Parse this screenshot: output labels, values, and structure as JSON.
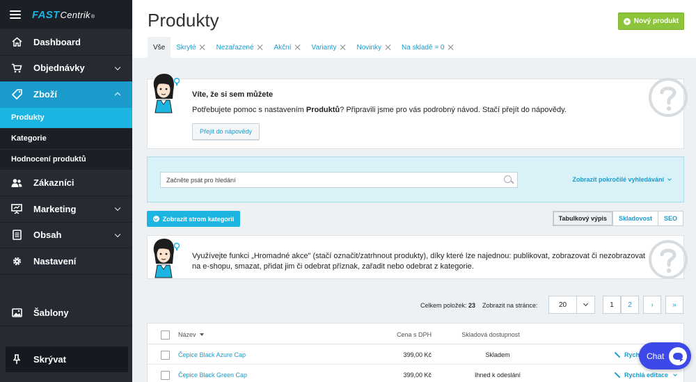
{
  "app": {
    "logo_fast": "FAST",
    "logo_centrik": "Centrik",
    "logo_reg": "®"
  },
  "sidebar": {
    "items": [
      {
        "label": "Dashboard",
        "icon": "home-icon"
      },
      {
        "label": "Objednávky",
        "icon": "cart-icon"
      },
      {
        "label": "Zboží",
        "icon": "tag-icon"
      },
      {
        "label": "Zákazníci",
        "icon": "users-icon"
      },
      {
        "label": "Marketing",
        "icon": "presentation-icon"
      },
      {
        "label": "Obsah",
        "icon": "document-icon"
      },
      {
        "label": "Nastavení",
        "icon": "gear-icon"
      },
      {
        "label": "Šablony",
        "icon": "image-icon"
      }
    ],
    "subitems": [
      {
        "label": "Produkty"
      },
      {
        "label": "Kategorie"
      },
      {
        "label": "Hodnocení produktů"
      }
    ],
    "hide_label": "Skrývat",
    "active_color": "#1a9bcb"
  },
  "header": {
    "title": "Produkty",
    "new_button": "Nový produkt",
    "new_button_color": "#8cc43c"
  },
  "tabs": [
    {
      "label": "Vše",
      "active": true
    },
    {
      "label": "Skryté"
    },
    {
      "label": "Nezařazené"
    },
    {
      "label": "Akční"
    },
    {
      "label": "Varianty"
    },
    {
      "label": "Novinky"
    },
    {
      "label": "Na skladě = 0"
    }
  ],
  "tip1": {
    "title": "Víte, že si sem můžete",
    "text_before": "Potřebujete pomoc s nastavením ",
    "text_bold": "Produktů",
    "text_after": "? Připravili jsme pro vás podrobný návod. Stačí přejít do nápovědy.",
    "button": "Přejít do nápovědy"
  },
  "search": {
    "placeholder": "Začněte psát pro hledání",
    "advanced": "Zobrazit pokročilé vyhledávání"
  },
  "toolbar": {
    "tree_button": "Zobrazit strom kategorií",
    "views": [
      "Tabulkový výpis",
      "Skladovost",
      "SEO"
    ],
    "active_view": "Tabulkový výpis"
  },
  "tip2": {
    "text": "Využívejte funkci „Hromadné akce\" (stačí označit/zatrhnout produkty), díky které lze najednou: publikovat, zobrazovat či nezobrazovat na e-shopu, smazat, přidat jim či odebrat příznak, zařadit nebo odebrat z kategorie."
  },
  "pager": {
    "count_label": "Celkem položek:",
    "count_value": "23",
    "perpage_label": "Zobrazit na stránce:",
    "perpage_value": "20",
    "pages": [
      "1",
      "2"
    ],
    "next": "›",
    "last": "»"
  },
  "table": {
    "headers": {
      "name": "Název",
      "price": "Cena s DPH",
      "stock": "Skladová dostupnost"
    },
    "rows": [
      {
        "name": "Čepice Black Azure Cap",
        "price": "399,00 Kč",
        "stock": "Skladem",
        "edit": "Rychlá editace"
      },
      {
        "name": "Čepice Black Green Cap",
        "price": "399,00 Kč",
        "stock": "Ihned k odeslání",
        "edit": "Rychlá editace"
      }
    ]
  },
  "chat": {
    "label": "Chat",
    "color": "#3d48e8"
  }
}
